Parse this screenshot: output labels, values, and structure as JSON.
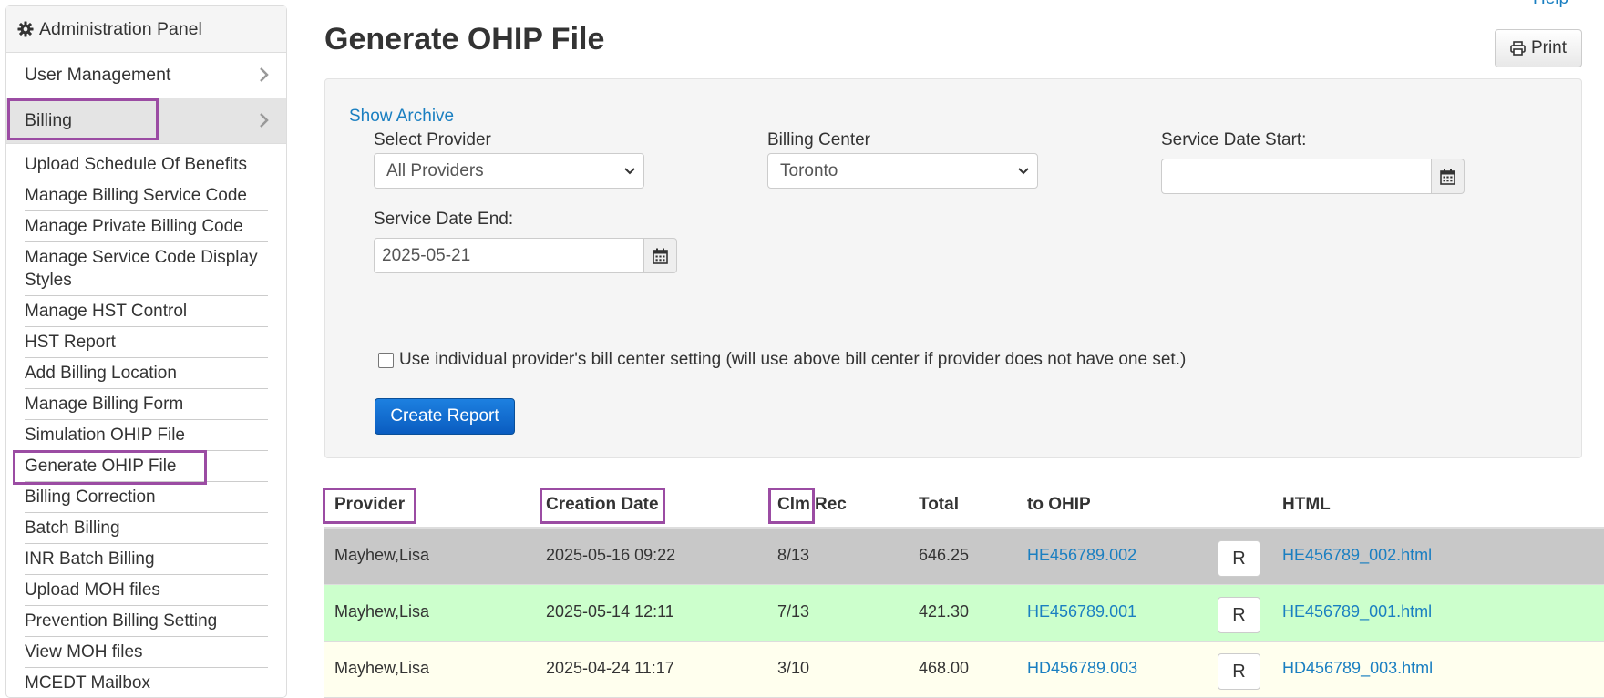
{
  "sidebar": {
    "title": "Administration Panel",
    "sections": [
      {
        "label": "User Management"
      },
      {
        "label": "Billing"
      }
    ],
    "billing_items": [
      "Upload Schedule Of Benefits",
      "Manage Billing Service Code",
      "Manage Private Billing Code",
      "Manage Service Code Display Styles",
      "Manage HST Control",
      "HST Report",
      "Add Billing Location",
      "Manage Billing Form",
      "Simulation OHIP File",
      "Generate OHIP File",
      "Billing Correction",
      "Batch Billing",
      "INR Batch Billing",
      "Upload MOH files",
      "Prevention Billing Setting",
      "View MOH files",
      "MCEDT Mailbox"
    ]
  },
  "page": {
    "title": "Generate OHIP File",
    "print_label": "Print",
    "top_link": "Help"
  },
  "form": {
    "show_archive": "Show Archive",
    "provider_label": "Select Provider",
    "provider_value": "All Providers",
    "center_label": "Billing Center",
    "center_value": "Toronto",
    "start_label": "Service Date Start:",
    "start_value": "",
    "end_label": "Service Date End:",
    "end_value": "2025-05-21",
    "checkbox_label": "Use individual provider's bill center setting (will use above bill center if provider does not have one set.)",
    "create_label": "Create Report"
  },
  "table": {
    "headers": {
      "provider": "Provider",
      "creation": "Creation Date",
      "clm": "Clm",
      "rec": "Rec",
      "total": "Total",
      "ohip": "to OHIP",
      "html": "HTML"
    },
    "rows": [
      {
        "provider": "Mayhew,Lisa",
        "date": "2025-05-16 09:22",
        "clmrec": "8/13",
        "total": "646.25",
        "ohip": "HE456789.002",
        "r": "R",
        "html": "HE456789_002.html",
        "bg": "#c8c8c8"
      },
      {
        "provider": "Mayhew,Lisa",
        "date": "2025-05-14 12:11",
        "clmrec": "7/13",
        "total": "421.30",
        "ohip": "HE456789.001",
        "r": "R",
        "html": "HE456789_001.html",
        "bg": "#ccffcc"
      },
      {
        "provider": "Mayhew,Lisa",
        "date": "2025-04-24 11:17",
        "clmrec": "3/10",
        "total": "468.00",
        "ohip": "HD456789.003",
        "r": "R",
        "html": "HD456789_003.html",
        "bg": "#ffffee"
      }
    ]
  },
  "colors": {
    "highlight": "#9b4ca3",
    "link": "#1a7fc1",
    "primary_button": "#0a5cc0"
  }
}
